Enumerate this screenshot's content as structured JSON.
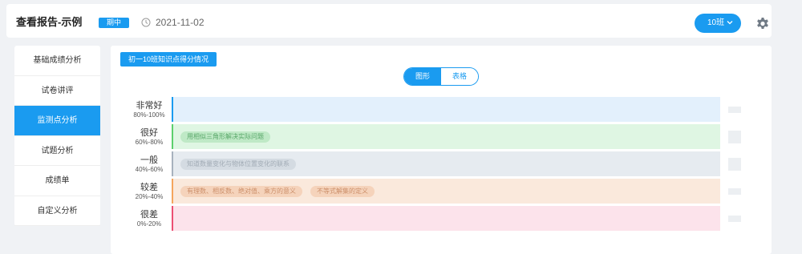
{
  "header": {
    "title": "查看报告-示例",
    "badge": "期中",
    "date": "2021-11-02",
    "class_select": "10班"
  },
  "sidebar": {
    "items": [
      {
        "label": "基础成绩分析"
      },
      {
        "label": "试卷讲评"
      },
      {
        "label": "监测点分析",
        "active": true
      },
      {
        "label": "试题分析"
      },
      {
        "label": "成绩单"
      },
      {
        "label": "自定义分析"
      }
    ]
  },
  "main": {
    "section_label": "初一10班知识点得分情况",
    "view_toggle": [
      "图形",
      "表格"
    ],
    "view_selected": "图形",
    "rows": [
      {
        "rating": "非常好",
        "range": "80%-100%",
        "tags": []
      },
      {
        "rating": "很好",
        "range": "60%-80%",
        "tags": [
          "用相似三角形解决实际问题"
        ]
      },
      {
        "rating": "一般",
        "range": "40%-60%",
        "tags": [
          "知道数量变化与物体位置变化的联系"
        ]
      },
      {
        "rating": "较差",
        "range": "20%-40%",
        "tags": [
          "有理数、相反数、绝对值、乘方的意义",
          "不等式解集的定义"
        ]
      },
      {
        "rating": "很差",
        "range": "0%-20%",
        "tags": []
      }
    ]
  },
  "colors": {
    "accent": "#1a9bf0",
    "very_good": "#1a9bf0",
    "good": "#5ccf6c",
    "average": "#a7b2be",
    "poor": "#f5a55d",
    "very_poor": "#ec4f73"
  }
}
